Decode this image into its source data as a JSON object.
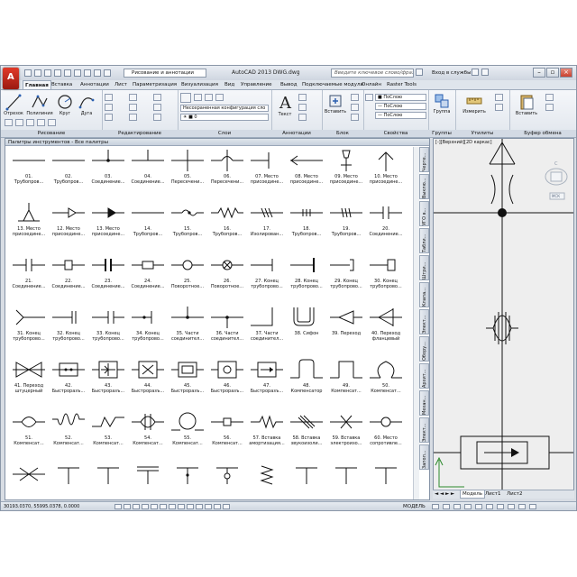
{
  "titlebar": {
    "workspace": "Рисование и аннотации",
    "title": "AutoCAD 2013    DWG.dwg",
    "search_placeholder": "Введите ключевое слово/фразу",
    "signin": "Вход в службы"
  },
  "tabs": [
    "Главная",
    "Вставка",
    "Аннотации",
    "Лист",
    "Параметризация",
    "Визуализация",
    "Вид",
    "Управление",
    "Вывод",
    "Подключаемые модули",
    "Онлайн",
    "Raster Tools"
  ],
  "ribbon": {
    "draw": {
      "title": "Рисование",
      "buttons": [
        "Отрезок",
        "Полилиния",
        "Круг",
        "Дуга"
      ]
    },
    "edit": {
      "title": "Редактирование"
    },
    "layers": {
      "title": "Слои",
      "combo": "Несохраненная конфигурация сло"
    },
    "annotations": {
      "title": "Аннотации",
      "text_btn": "Текст"
    },
    "block": {
      "title": "Блок",
      "insert_btn": "Вставить"
    },
    "properties": {
      "title": "Свойства",
      "combo1": "ПоСлою",
      "combo2": "ПоСлою",
      "combo3": "ПоСлою"
    },
    "groups": {
      "title": "Группы",
      "btn": "Группа"
    },
    "utilities": {
      "title": "Утилиты",
      "btn": "Измерить"
    },
    "clipboard": {
      "title": "Буфер обмена",
      "btn": "Вставить"
    }
  },
  "palette": {
    "title": "Палитры инструментов - Все палитры",
    "tabs": [
      "Черте...",
      "Выклю...",
      "УГО в...",
      "Табли...",
      "Штри...",
      "Клапа...",
      "Элект...",
      "Обору...",
      "Архит...",
      "Механ...",
      "Элект...",
      "Запол..."
    ],
    "tools": [
      {
        "label": "01.\nТрубопров...",
        "sym": "line"
      },
      {
        "label": "02.\nТрубопров...",
        "sym": "line"
      },
      {
        "label": "03.\nСоединение...",
        "sym": "tee-dot"
      },
      {
        "label": "04.\nСоединение...",
        "sym": "tee"
      },
      {
        "label": "05.\nПересечени...",
        "sym": "cross"
      },
      {
        "label": "06.\nПересечени...",
        "sym": "cross-bridge"
      },
      {
        "label": "07. Место\nприсоедине...",
        "sym": "tee-end"
      },
      {
        "label": "08. Место\nприсоедине...",
        "sym": "arrow-left"
      },
      {
        "label": "09. Место\nприсоедине...",
        "sym": "funnel"
      },
      {
        "label": "10. Место\nприсоедине...",
        "sym": "angle"
      },
      {
        "label": "13. Место\nприсоедине...",
        "sym": "triangle-up"
      },
      {
        "label": "12. Место\nприсоедине...",
        "sym": "arrow-open"
      },
      {
        "label": "13. Место\nприсоедине...",
        "sym": "arrow-fill"
      },
      {
        "label": "14.\nТрубопров...",
        "sym": "line"
      },
      {
        "label": "15.\nТрубопров...",
        "sym": "wave-dot"
      },
      {
        "label": "16.\nТрубопров...",
        "sym": "zigzag"
      },
      {
        "label": "17.\nИзолирован...",
        "sym": "hatch"
      },
      {
        "label": "18.\nТрубопров...",
        "sym": "ticks"
      },
      {
        "label": "19.\nТрубопров...",
        "sym": "ticks2"
      },
      {
        "label": "20.\nСоединение...",
        "sym": "double-bar"
      },
      {
        "label": "21.\nСоединение...",
        "sym": "double-bar"
      },
      {
        "label": "22.\nСоединение...",
        "sym": "flange-box"
      },
      {
        "label": "23.\nСоединение...",
        "sym": "flange"
      },
      {
        "label": "24.\nСоединение...",
        "sym": "pipe-box"
      },
      {
        "label": "25.\nПоворотное...",
        "sym": "circle-line"
      },
      {
        "label": "26.\nПоворотное...",
        "sym": "circle-cross"
      },
      {
        "label": "27. Конец\nтрубопрово...",
        "sym": "end-bar"
      },
      {
        "label": "28. Конец\nтрубопрово...",
        "sym": "end-bar2"
      },
      {
        "label": "29. Конец\nтрубопрово...",
        "sym": "end-cap"
      },
      {
        "label": "30. Конец\nтрубопрово...",
        "sym": "end-box"
      },
      {
        "label": "31. Конец\nтрубопрово...",
        "sym": "end-fork"
      },
      {
        "label": "32. Конец\nтрубопрово...",
        "sym": "end-double"
      },
      {
        "label": "33. Конец\nтрубопрово...",
        "sym": "end-double2"
      },
      {
        "label": "34. Конец\nтрубопрово...",
        "sym": "end-dot-bar"
      },
      {
        "label": "35. Части\nсоединител...",
        "sym": "tee-dot"
      },
      {
        "label": "36. Части\nсоединител...",
        "sym": "tee-dot-down"
      },
      {
        "label": "37. Части\nсоединител...",
        "sym": "corner"
      },
      {
        "label": "38. Сифон",
        "sym": "siphon"
      },
      {
        "label": "39. Переход",
        "sym": "reducer"
      },
      {
        "label": "40. Переход\nфланцевый",
        "sym": "reducer-flange"
      },
      {
        "label": "41. Переход\nштуцерный",
        "sym": "bowtie"
      },
      {
        "label": "42.\nБыстроразъ...",
        "sym": "box-dots"
      },
      {
        "label": "43.\nБыстроразъ...",
        "sym": "box-arrows"
      },
      {
        "label": "44.\nБыстроразъ...",
        "sym": "box-arrows2"
      },
      {
        "label": "45.\nБыстроразъ...",
        "sym": "box-double"
      },
      {
        "label": "46.\nБыстроразъ...",
        "sym": "box-circle"
      },
      {
        "label": "47.\nБыстроразъ...",
        "sym": "box-arrow"
      },
      {
        "label": "48.\nКомпенсатор",
        "sym": "u-loop"
      },
      {
        "label": "49.\nКомпенсат...",
        "sym": "u-loop2"
      },
      {
        "label": "50.\nКомпенсат...",
        "sym": "omega"
      },
      {
        "label": "51.\nКомпенсат...",
        "sym": "lens"
      },
      {
        "label": "52.\nКомпенсат...",
        "sym": "waves"
      },
      {
        "label": "53.\nКомпенсат...",
        "sym": "zigzag-arrow"
      },
      {
        "label": "54.\nКомпенсат...",
        "sym": "lens-bars"
      },
      {
        "label": "55.\nКомпенсат...",
        "sym": "circle-big"
      },
      {
        "label": "56.\nКомпенсат...",
        "sym": "step"
      },
      {
        "label": "57. Вставка\nамортизация...",
        "sym": "zig-small"
      },
      {
        "label": "58. Вставка\nзвукоизоли...",
        "sym": "hatch2"
      },
      {
        "label": "59. Вставка\nэлектроизо...",
        "sym": "cross-x"
      },
      {
        "label": "60. Место\nсопротивле...",
        "sym": "circle-line"
      },
      {
        "label": "",
        "sym": "x-cross"
      },
      {
        "label": "",
        "sym": "t-bar"
      },
      {
        "label": "",
        "sym": "t-bar"
      },
      {
        "label": "",
        "sym": "t-double"
      },
      {
        "label": "",
        "sym": "t-dot"
      },
      {
        "label": "",
        "sym": "t-circle"
      },
      {
        "label": "",
        "sym": "spring"
      },
      {
        "label": "",
        "sym": "t-bar"
      },
      {
        "label": "",
        "sym": "t-bar"
      },
      {
        "label": "",
        "sym": "t-bar"
      }
    ]
  },
  "drawing": {
    "view_label": "[-][Верхний][2D каркас]",
    "viewcube_labels": [
      "С",
      "МСК"
    ],
    "model_tabs": [
      "Модель",
      "Лист1",
      "Лист2"
    ]
  },
  "status": {
    "coords": "30193.0370, 55995.0378, 0.0000",
    "model": "МОДЕЛЬ"
  },
  "icons": {
    "logo": "autocad-logo-icon"
  }
}
